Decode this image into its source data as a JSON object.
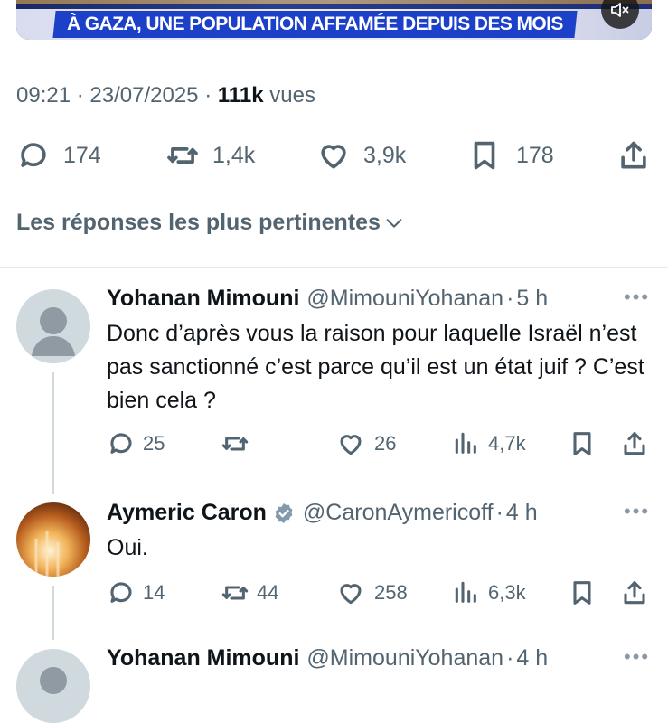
{
  "video": {
    "caption": "À GAZA, UNE POPULATION AFFAMÉE DEPUIS DES MOIS",
    "mute_icon": "speaker-muted-icon"
  },
  "tweet": {
    "time": "09:21",
    "date": "23/07/2025",
    "views_count": "111k",
    "views_label": "vues",
    "replies": "174",
    "reposts": "1,4k",
    "likes": "3,9k",
    "bookmarks": "178"
  },
  "sort_label": "Les réponses les plus pertinentes",
  "replies": [
    {
      "name": "Yohanan Mimouni",
      "handle": "@MimouniYohanan",
      "age": "5 h",
      "text": "Donc d’après vous la raison pour laquelle Israël n’est pas sanctionné c’est parce qu’il est un état juif ? C’est bien cela ?",
      "replies": "25",
      "reposts": "",
      "likes": "26",
      "views": "4,7k"
    },
    {
      "name": "Aymeric Caron",
      "verified": true,
      "handle": "@CaronAymericoff",
      "age": "4 h",
      "text": "Oui.",
      "replies": "14",
      "reposts": "44",
      "likes": "258",
      "views": "6,3k"
    },
    {
      "name": "Yohanan Mimouni",
      "handle": "@MimouniYohanan",
      "age": "4 h"
    }
  ],
  "colors": {
    "text": "#0f1419",
    "secondary": "#536471",
    "verified": "#829aab",
    "caption_bg": "#1d40c9"
  }
}
